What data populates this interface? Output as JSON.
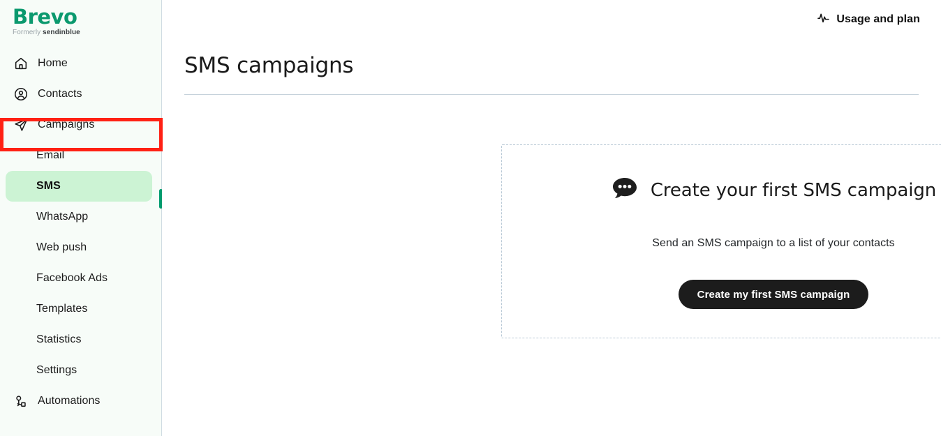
{
  "brand": {
    "name": "Brevo",
    "formerly_prefix": "Formerly",
    "formerly_name": "sendinblue",
    "logo_color": "#0b996e"
  },
  "sidebar": {
    "items": [
      {
        "label": "Home",
        "icon": "home-icon"
      },
      {
        "label": "Contacts",
        "icon": "contacts-icon"
      },
      {
        "label": "Campaigns",
        "icon": "paper-plane-icon"
      }
    ],
    "sub_items": [
      {
        "label": "Email",
        "active": false
      },
      {
        "label": "SMS",
        "active": true
      },
      {
        "label": "WhatsApp",
        "active": false
      },
      {
        "label": "Web push",
        "active": false
      },
      {
        "label": "Facebook Ads",
        "active": false
      },
      {
        "label": "Templates",
        "active": false
      },
      {
        "label": "Statistics",
        "active": false
      },
      {
        "label": "Settings",
        "active": false
      }
    ],
    "bottom_items": [
      {
        "label": "Automations",
        "icon": "automation-flow-icon"
      }
    ],
    "active_color": "#009b6e",
    "active_pill_color": "#ccf3d4",
    "background": "#f7fcf8"
  },
  "annotation": {
    "target": "Campaigns",
    "color": "#ff2114"
  },
  "topbar": {
    "usage_and_plan": "Usage and plan",
    "usage_icon": "activity-pulse-icon"
  },
  "page": {
    "title": "SMS campaigns"
  },
  "empty_state": {
    "icon": "speech-bubble-dots-icon",
    "title": "Create your first SMS campaign",
    "subtitle": "Send an SMS campaign to a list of your contacts",
    "cta_label": "Create my first SMS campaign",
    "cta_background": "#1c1c1c",
    "border_style": "dashed",
    "border_color": "#b9c9d6"
  }
}
